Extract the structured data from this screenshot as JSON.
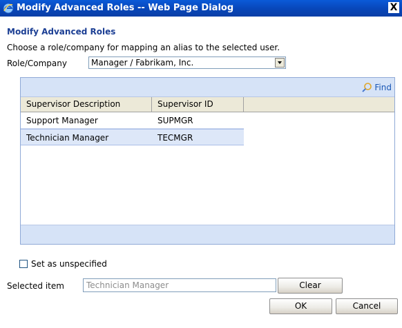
{
  "window": {
    "title": "Modify Advanced Roles -- Web Page Dialog",
    "close_glyph": "X"
  },
  "dialog": {
    "heading": "Modify Advanced Roles",
    "instructions": "Choose a role/company for mapping an alias to the selected user.",
    "role_label": "Role/Company",
    "role_value": "Manager / Fabrikam, Inc."
  },
  "grid": {
    "find_label": "Find",
    "columns": [
      "Supervisor Description",
      "Supervisor ID"
    ],
    "rows": [
      {
        "description": "Support Manager",
        "id": "SUPMGR",
        "selected": false
      },
      {
        "description": "Technician Manager",
        "id": "TECMGR",
        "selected": true
      }
    ]
  },
  "options": {
    "unspecified_label": "Set as unspecified",
    "unspecified_checked": false
  },
  "selection": {
    "label": "Selected item",
    "value": "Technician Manager"
  },
  "buttons": {
    "clear": "Clear",
    "ok": "OK",
    "cancel": "Cancel"
  },
  "colors": {
    "titlebar": "#0a5ad8",
    "heading": "#1c3f94",
    "grid_band": "#d6e3f7",
    "selected_row": "#dde7f8",
    "link": "#1a57b5"
  }
}
